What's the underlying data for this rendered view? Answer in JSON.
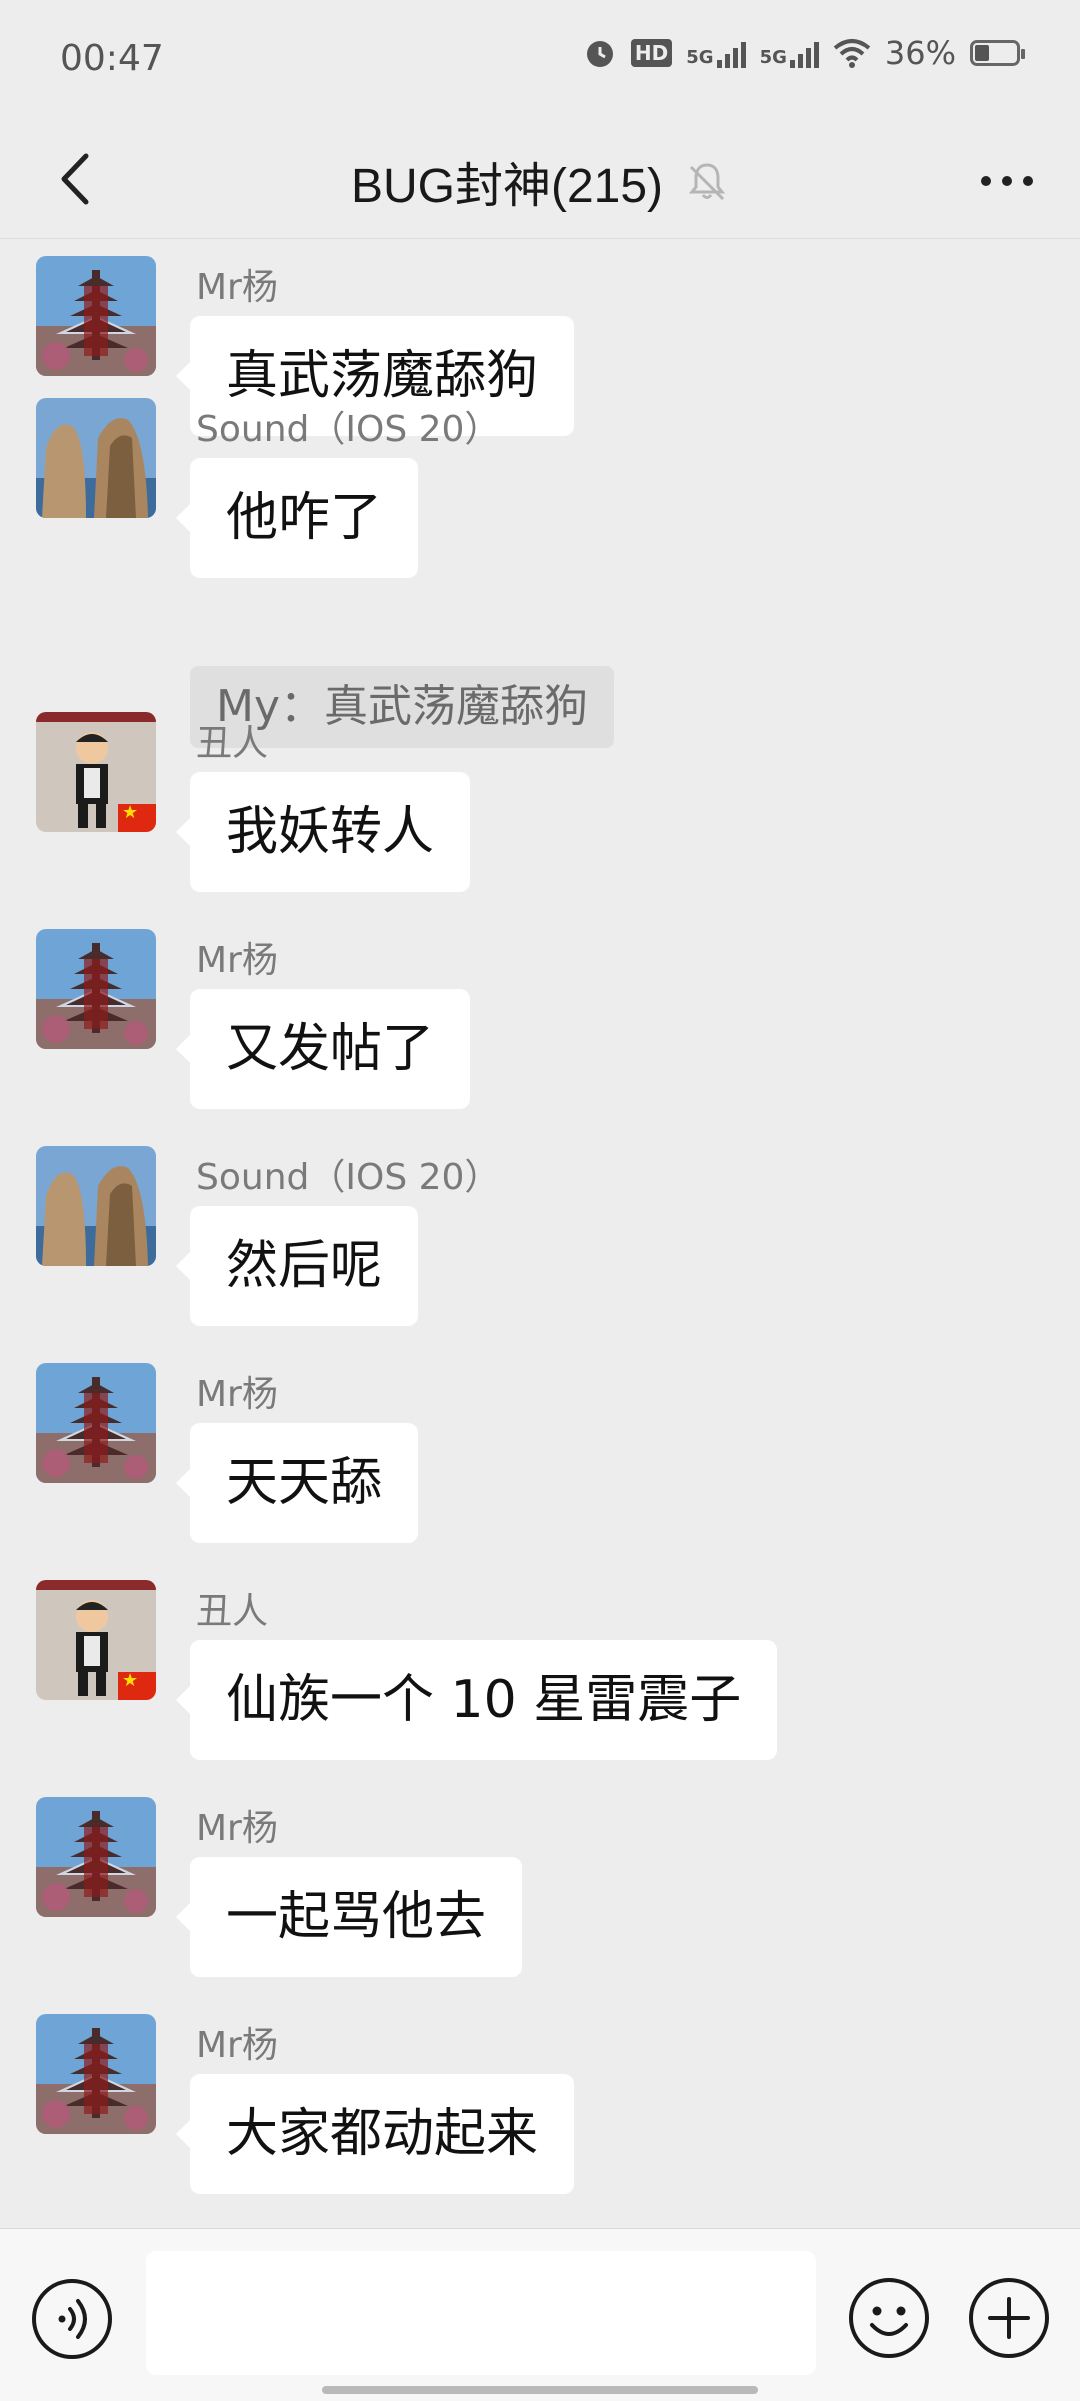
{
  "status_bar": {
    "time": "00:47",
    "battery": "36%",
    "net_hd": "HD",
    "net_5g_1": "5G",
    "net_5g_2": "5G"
  },
  "header": {
    "title": "BUG封神(215)"
  },
  "messages": [
    {
      "sender": "Mr杨",
      "text": "真武荡魔舔狗",
      "avatar": "pagoda"
    },
    {
      "sender": "Sound（IOS 20）",
      "text": "他咋了",
      "avatar": "rock",
      "quote": "My：真武荡魔舔狗"
    },
    {
      "sender": "丑人",
      "text": "我妖转人",
      "avatar": "child"
    },
    {
      "sender": "Mr杨",
      "text": "又发帖了",
      "avatar": "pagoda"
    },
    {
      "sender": "Sound（IOS 20）",
      "text": "然后呢",
      "avatar": "rock"
    },
    {
      "sender": "Mr杨",
      "text": "天天舔",
      "avatar": "pagoda"
    },
    {
      "sender": "丑人",
      "text": "仙族一个 10 星雷震子",
      "avatar": "child"
    },
    {
      "sender": "Mr杨",
      "text": "一起骂他去",
      "avatar": "pagoda"
    },
    {
      "sender": "Mr杨",
      "text": "大家都动起来",
      "avatar": "pagoda"
    }
  ],
  "input_bar": {
    "placeholder": ""
  },
  "icons": {
    "back": "chevron-left-icon",
    "mute": "bell-muted-icon",
    "more": "more-icon",
    "voice": "voice-icon",
    "emoji": "emoji-icon",
    "plus": "plus-icon"
  }
}
